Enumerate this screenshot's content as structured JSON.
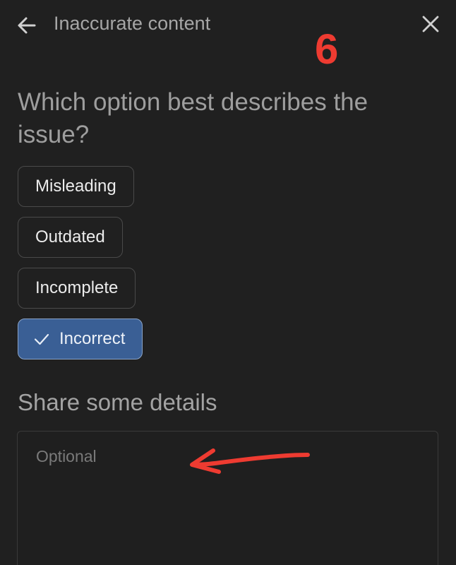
{
  "header": {
    "title": "Inaccurate content",
    "back_icon": "arrow-left-icon",
    "close_icon": "close-icon"
  },
  "annotation": {
    "step_number": "6",
    "color": "#ee3b31"
  },
  "question": "Which option best describes the issue?",
  "options": [
    {
      "label": "Misleading",
      "selected": false
    },
    {
      "label": "Outdated",
      "selected": false
    },
    {
      "label": "Incomplete",
      "selected": false
    },
    {
      "label": "Incorrect",
      "selected": true
    }
  ],
  "details": {
    "title": "Share some details",
    "placeholder": "Optional",
    "value": ""
  },
  "colors": {
    "background": "#202020",
    "selected_chip": "#3a5f95",
    "chip_border": "#4a4a4a"
  }
}
